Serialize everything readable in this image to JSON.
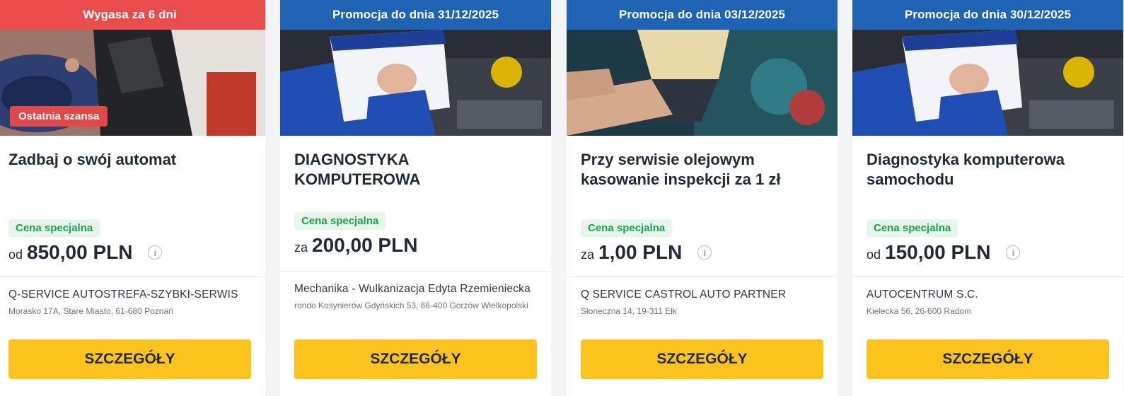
{
  "cards": [
    {
      "banner": "Wygasa za 6 dni",
      "label": "Ostatnia szansa",
      "title": "Zadbaj o swój automat",
      "badge": "Cena specjalna",
      "price_prefix": "od",
      "price": "850,00 PLN",
      "info_icon": "info-icon",
      "shop_name": "Q-SERVICE AUTOSTREFA-SZYBKI-SERWIS",
      "shop_address": "Morasko 17A, Stare Miasto, 61-680 Poznań",
      "button": "SZCZEGÓŁY",
      "banner_color": "#ea4b4b"
    },
    {
      "banner": "Promocja do dnia 31/12/2025",
      "title": "DIAGNOSTYKA KOMPUTEROWA",
      "badge": "Cena specjalna",
      "price_prefix": "za",
      "price": "200,00 PLN",
      "shop_name": "Mechanika - Wulkanizacja Edyta Rzemieniecka",
      "shop_address": "rondo Kosynierów Gdyńskich 53, 66-400 Gorzów Wielkopolski",
      "button": "SZCZEGÓŁY",
      "banner_color": "#1e63b4"
    },
    {
      "banner": "Promocja do dnia 03/12/2025",
      "title": "Przy serwisie olejowym kasowanie inspekcji za 1 zł",
      "badge": "Cena specjalna",
      "price_prefix": "za",
      "price": "1,00 PLN",
      "info_icon": "info-icon",
      "shop_name": "Q SERVICE CASTROL AUTO PARTNER",
      "shop_address": "Słoneczna 14, 19-311 Ełk",
      "button": "SZCZEGÓŁY",
      "banner_color": "#1e63b4"
    },
    {
      "banner": "Promocja do dnia 30/12/2025",
      "title": "Diagnostyka komputerowa samochodu",
      "badge": "Cena specjalna",
      "price_prefix": "od",
      "price": "150,00 PLN",
      "info_icon": "info-icon",
      "shop_name": "AUTOCENTRUM S.C.",
      "shop_address": "Kielecka 56, 26-600 Radom",
      "button": "SZCZEGÓŁY",
      "banner_color": "#1e63b4"
    }
  ],
  "colors": {
    "accent_button": "#fdc31d",
    "badge_green": "#1aa34a",
    "expiring_red": "#ea4b4b",
    "promo_blue": "#1e63b4"
  }
}
